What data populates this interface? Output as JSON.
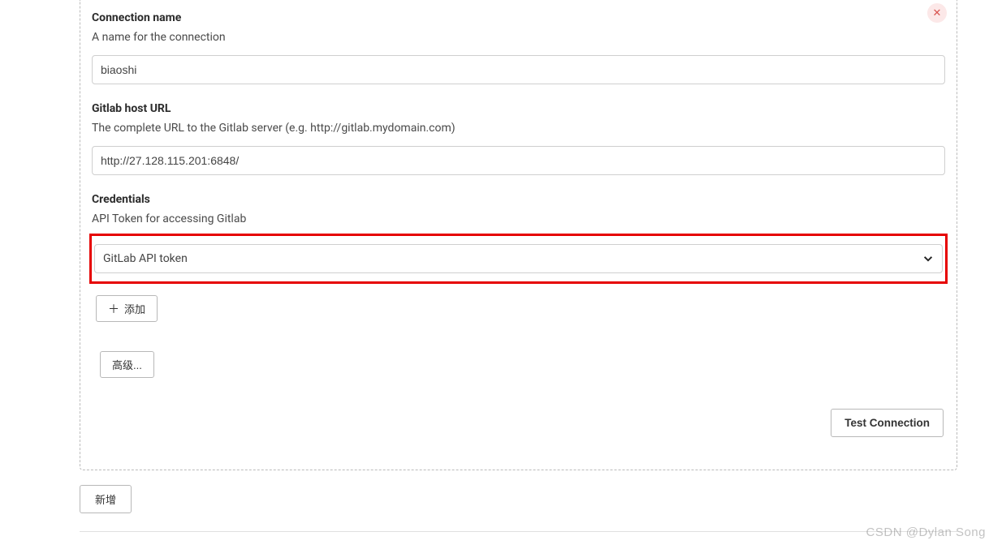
{
  "form": {
    "connection_name": {
      "label": "Connection name",
      "desc": "A name for the connection",
      "value": "biaoshi"
    },
    "host_url": {
      "label": "Gitlab host URL",
      "desc": "The complete URL to the Gitlab server (e.g. http://gitlab.mydomain.com)",
      "value": "http://27.128.115.201:6848/"
    },
    "credentials": {
      "label": "Credentials",
      "desc": "API Token for accessing Gitlab",
      "selected": "GitLab API token"
    }
  },
  "buttons": {
    "add": "添加",
    "advanced": "高级...",
    "test_connection": "Test Connection",
    "new": "新增"
  },
  "watermark": "CSDN @Dylan  Song"
}
